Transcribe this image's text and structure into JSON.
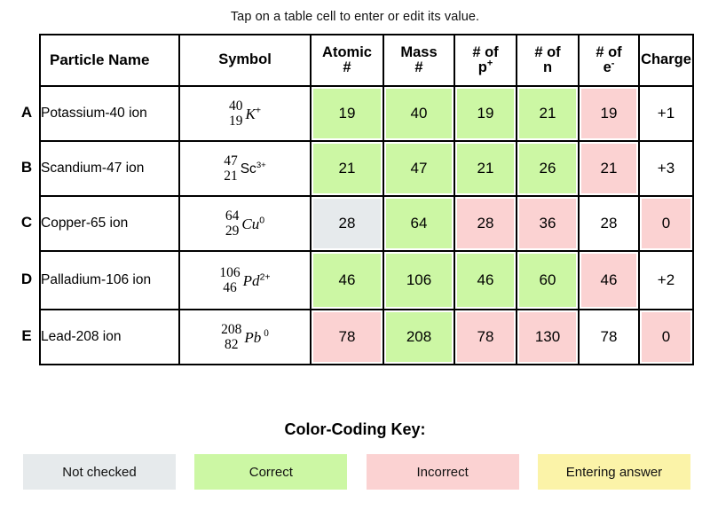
{
  "instruction": "Tap on a table cell to enter or edit its value.",
  "colors": {
    "not_checked": "#e6eaec",
    "correct": "#ccf7a4",
    "incorrect": "#fbd2d2",
    "entering": "#fbf3a8",
    "none": "#ffffff",
    "border": "#000000"
  },
  "table": {
    "headers": [
      {
        "label": "Particle Name",
        "name": "particle-name"
      },
      {
        "label": "Symbol",
        "name": "symbol"
      },
      {
        "label_line1": "Atomic",
        "label_line2": "#",
        "name": "atomic-number"
      },
      {
        "label_line1": "Mass",
        "label_line2": "#",
        "name": "mass-number"
      },
      {
        "label_line1": "# of",
        "label_line2": "p",
        "sup": "+",
        "name": "protons"
      },
      {
        "label_line1": "# of",
        "label_line2": "n",
        "sup": "",
        "name": "neutrons"
      },
      {
        "label_line1": "# of",
        "label_line2": "e",
        "sup": "-",
        "name": "electrons"
      },
      {
        "label": "Charge",
        "name": "charge"
      }
    ],
    "rows": [
      {
        "row_label": "A",
        "particle_name": "Potassium-40 ion",
        "symbol": {
          "mass": "40",
          "atomic": "19",
          "element": "K",
          "charge": "+",
          "style": "italic",
          "charge_spaced": false
        },
        "cells": [
          {
            "value": "19",
            "state": "correct"
          },
          {
            "value": "40",
            "state": "correct"
          },
          {
            "value": "19",
            "state": "correct"
          },
          {
            "value": "21",
            "state": "correct"
          },
          {
            "value": "19",
            "state": "incorrect"
          },
          {
            "value": "+1",
            "state": "none"
          }
        ]
      },
      {
        "row_label": "B",
        "particle_name": "Scandium-47 ion",
        "symbol": {
          "mass": "47",
          "atomic": "21",
          "element": "Sc",
          "charge": "3+",
          "style": "upright",
          "charge_spaced": false
        },
        "cells": [
          {
            "value": "21",
            "state": "correct"
          },
          {
            "value": "47",
            "state": "correct"
          },
          {
            "value": "21",
            "state": "correct"
          },
          {
            "value": "26",
            "state": "correct"
          },
          {
            "value": "21",
            "state": "incorrect"
          },
          {
            "value": "+3",
            "state": "none"
          }
        ]
      },
      {
        "row_label": "C",
        "particle_name": "Copper-65 ion",
        "symbol": {
          "mass": "64",
          "atomic": "29",
          "element": "Cu",
          "charge": "0",
          "style": "italic",
          "charge_spaced": false
        },
        "cells": [
          {
            "value": "28",
            "state": "not_checked"
          },
          {
            "value": "64",
            "state": "correct"
          },
          {
            "value": "28",
            "state": "incorrect"
          },
          {
            "value": "36",
            "state": "incorrect"
          },
          {
            "value": "28",
            "state": "none"
          },
          {
            "value": "0",
            "state": "incorrect"
          }
        ]
      },
      {
        "row_label": "D",
        "particle_name": "Palladium-106 ion",
        "symbol": {
          "mass": "106",
          "atomic": "46",
          "element": "Pd",
          "charge": "2+",
          "style": "italic",
          "charge_spaced": false
        },
        "cells": [
          {
            "value": "46",
            "state": "correct"
          },
          {
            "value": "106",
            "state": "correct"
          },
          {
            "value": "46",
            "state": "correct"
          },
          {
            "value": "60",
            "state": "correct"
          },
          {
            "value": "46",
            "state": "incorrect"
          },
          {
            "value": "+2",
            "state": "none"
          }
        ]
      },
      {
        "row_label": "E",
        "particle_name": "Lead-208 ion",
        "symbol": {
          "mass": "208",
          "atomic": "82",
          "element": "Pb",
          "charge": "0",
          "style": "italic",
          "charge_spaced": true
        },
        "cells": [
          {
            "value": "78",
            "state": "incorrect"
          },
          {
            "value": "208",
            "state": "correct"
          },
          {
            "value": "78",
            "state": "incorrect"
          },
          {
            "value": "130",
            "state": "incorrect"
          },
          {
            "value": "78",
            "state": "none"
          },
          {
            "value": "0",
            "state": "incorrect"
          }
        ]
      }
    ]
  },
  "key": {
    "title": "Color-Coding Key:",
    "items": [
      {
        "label": "Not checked",
        "state": "not_checked"
      },
      {
        "label": "Correct",
        "state": "correct"
      },
      {
        "label": "Incorrect",
        "state": "incorrect"
      },
      {
        "label": "Entering answer",
        "state": "entering"
      }
    ]
  }
}
